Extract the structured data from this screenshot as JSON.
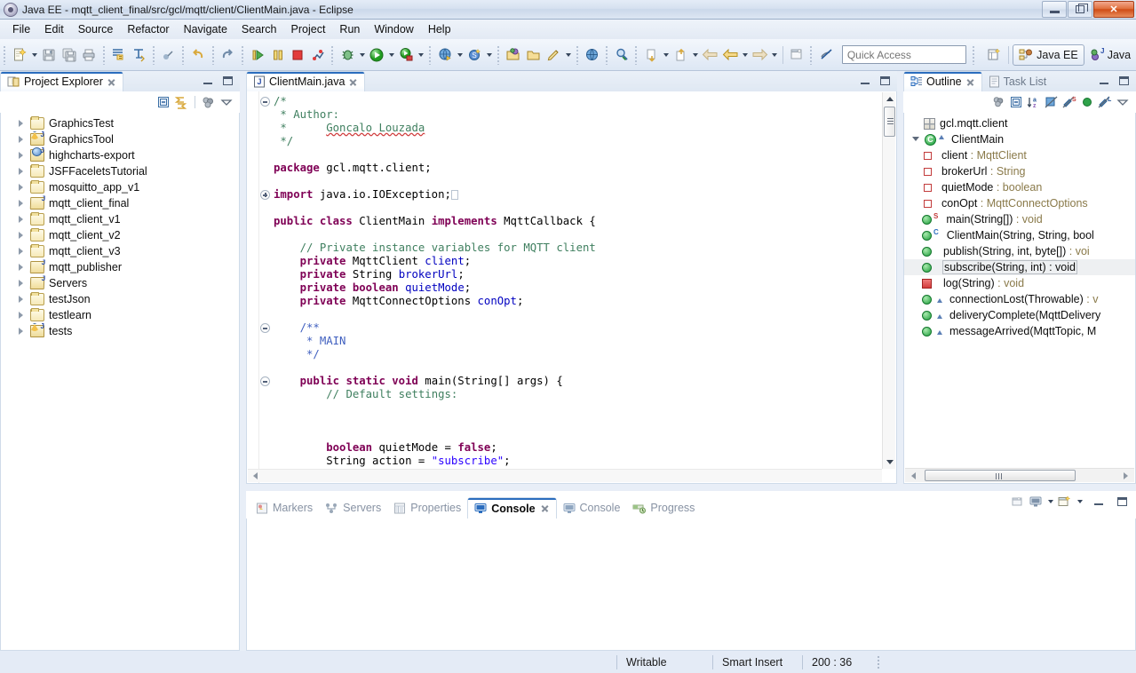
{
  "window": {
    "title": "Java EE - mqtt_client_final/src/gcl/mqtt/client/ClientMain.java - Eclipse",
    "app_icon": "eclipse-icon",
    "buttons": {
      "minimize": "minimize-button",
      "restore": "restore-button",
      "close": "close-button"
    }
  },
  "menubar": {
    "items": [
      "File",
      "Edit",
      "Source",
      "Refactor",
      "Navigate",
      "Search",
      "Project",
      "Run",
      "Window",
      "Help"
    ]
  },
  "toolbar": {
    "groups": [
      {
        "icons": [
          "new-wizard-icon",
          "new-wizard-dropdown",
          "save-icon",
          "save-all-icon",
          "print-icon"
        ]
      },
      {
        "icons": [
          "build-all-icon",
          "externalize-strings-icon"
        ]
      },
      {
        "icons": [
          "skip-breakpoints-icon"
        ]
      },
      {
        "icons": [
          "undo-icon"
        ]
      },
      {
        "icons": [
          "redo-icon"
        ]
      },
      {
        "icons": [
          "resume-icon",
          "suspend-icon",
          "terminate-icon",
          "disconnect-icon"
        ]
      },
      {
        "icons": [
          "debug-icon",
          "debug-dropdown",
          "run-icon",
          "run-dropdown",
          "run-coverage-icon",
          "run-coverage-dropdown"
        ]
      },
      {
        "icons": [
          "run-on-server-icon",
          "run-on-server-dropdown",
          "new-server-icon",
          "new-server-dropdown"
        ]
      },
      {
        "icons": [
          "open-type-icon",
          "open-task-icon",
          "new-java-class-icon",
          "new-java-class-dropdown"
        ]
      },
      {
        "icons": [
          "web-browser-icon"
        ]
      },
      {
        "icons": [
          "search-icon"
        ]
      },
      {
        "icons": [
          "next-annotation-icon",
          "next-annotation-dropdown",
          "previous-annotation-icon",
          "previous-annotation-dropdown",
          "back-icon",
          "back-dropdown",
          "forward-icon",
          "forward-dropdown"
        ]
      },
      {
        "icons": [
          "new-editor-icon",
          "toggle-mark-occurrences-icon"
        ]
      }
    ],
    "quick_access_placeholder": "Quick Access",
    "open-perspective-icon": "open-perspective-icon",
    "perspectives": [
      {
        "label": "Java EE",
        "icon": "java-ee-perspective-icon",
        "active": true
      },
      {
        "label": "Java",
        "icon": "java-perspective-icon",
        "active": false
      }
    ]
  },
  "project_explorer": {
    "tab_label": "Project Explorer",
    "tab_icon": "project-explorer-icon",
    "toolbar_icons": [
      "collapse-all-icon",
      "link-with-editor-icon",
      "view-menu-filters-icon",
      "view-menu-icon"
    ],
    "view_controls": [
      "minimize-view-icon",
      "maximize-view-icon"
    ],
    "items": [
      {
        "label": "GraphicsTest",
        "icon": "folder-icon"
      },
      {
        "label": "GraphicsTool",
        "icon": "java-project-warning-icon"
      },
      {
        "label": "highcharts-export",
        "icon": "java-project-icon"
      },
      {
        "label": "JSFFaceletsTutorial",
        "icon": "folder-icon"
      },
      {
        "label": "mosquitto_app_v1",
        "icon": "folder-icon"
      },
      {
        "label": "mqtt_client_final",
        "icon": "open-java-project-icon"
      },
      {
        "label": "mqtt_client_v1",
        "icon": "folder-icon"
      },
      {
        "label": "mqtt_client_v2",
        "icon": "folder-icon"
      },
      {
        "label": "mqtt_client_v3",
        "icon": "folder-icon"
      },
      {
        "label": "mqtt_publisher",
        "icon": "open-java-project-icon"
      },
      {
        "label": "Servers",
        "icon": "open-folder-icon"
      },
      {
        "label": "testJson",
        "icon": "folder-icon"
      },
      {
        "label": "testlearn",
        "icon": "folder-icon"
      },
      {
        "label": "tests",
        "icon": "java-project-warning-icon"
      }
    ]
  },
  "editor": {
    "tab_label": "ClientMain.java",
    "tab_icon": "java-file-icon",
    "view_controls": [
      "minimize-editor-icon",
      "maximize-editor-icon"
    ],
    "code_lines": [
      {
        "segments": [
          {
            "t": "/*",
            "c": "cmt"
          }
        ],
        "fold": "minus"
      },
      {
        "segments": [
          {
            "t": " * Author:",
            "c": "cmt"
          }
        ]
      },
      {
        "segments": [
          {
            "t": " *      ",
            "c": "cmt"
          },
          {
            "t": "Goncalo Louzada",
            "c": "cmt squig"
          }
        ]
      },
      {
        "segments": [
          {
            "t": " */",
            "c": "cmt"
          }
        ]
      },
      {
        "segments": [
          {
            "t": "",
            "c": ""
          }
        ]
      },
      {
        "segments": [
          {
            "t": "package",
            "c": "kw"
          },
          {
            "t": " gcl.mqtt.client;",
            "c": ""
          }
        ]
      },
      {
        "segments": [
          {
            "t": "",
            "c": ""
          }
        ]
      },
      {
        "segments": [
          {
            "t": "import",
            "c": "kw"
          },
          {
            "t": " java.io.IOException;",
            "c": ""
          },
          {
            "t": "BOX",
            "c": "box"
          }
        ],
        "fold": "plus"
      },
      {
        "segments": [
          {
            "t": "",
            "c": ""
          }
        ]
      },
      {
        "segments": [
          {
            "t": "public class",
            "c": "kw"
          },
          {
            "t": " ClientMain ",
            "c": ""
          },
          {
            "t": "implements",
            "c": "kw"
          },
          {
            "t": " MqttCallback {",
            "c": ""
          }
        ]
      },
      {
        "segments": [
          {
            "t": "",
            "c": ""
          }
        ]
      },
      {
        "segments": [
          {
            "t": "    // Private instance variables for MQTT client",
            "c": "cmt"
          }
        ]
      },
      {
        "segments": [
          {
            "t": "    private",
            "c": "kw"
          },
          {
            "t": " MqttClient ",
            "c": ""
          },
          {
            "t": "client",
            "c": "fld"
          },
          {
            "t": ";",
            "c": ""
          }
        ]
      },
      {
        "segments": [
          {
            "t": "    private",
            "c": "kw"
          },
          {
            "t": " String ",
            "c": ""
          },
          {
            "t": "brokerUrl",
            "c": "fld"
          },
          {
            "t": ";",
            "c": ""
          }
        ]
      },
      {
        "segments": [
          {
            "t": "    private boolean",
            "c": "kw"
          },
          {
            "t": " ",
            "c": ""
          },
          {
            "t": "quietMode",
            "c": "fld"
          },
          {
            "t": ";",
            "c": ""
          }
        ]
      },
      {
        "segments": [
          {
            "t": "    private",
            "c": "kw"
          },
          {
            "t": " MqttConnectOptions ",
            "c": ""
          },
          {
            "t": "conOpt",
            "c": "fld"
          },
          {
            "t": ";",
            "c": ""
          }
        ]
      },
      {
        "segments": [
          {
            "t": "",
            "c": ""
          }
        ]
      },
      {
        "segments": [
          {
            "t": "    /**",
            "c": "jdoc"
          }
        ],
        "fold": "minus"
      },
      {
        "segments": [
          {
            "t": "     * MAIN",
            "c": "jdoc"
          }
        ]
      },
      {
        "segments": [
          {
            "t": "     */",
            "c": "jdoc"
          }
        ]
      },
      {
        "segments": [
          {
            "t": "",
            "c": ""
          }
        ]
      },
      {
        "segments": [
          {
            "t": "    public static void",
            "c": "kw"
          },
          {
            "t": " main(String[] args) {",
            "c": ""
          }
        ],
        "fold": "minus"
      },
      {
        "segments": [
          {
            "t": "        // Default settings:",
            "c": "cmt"
          }
        ]
      },
      {
        "segments": [
          {
            "t": "",
            "c": ""
          }
        ]
      },
      {
        "segments": [
          {
            "t": "",
            "c": ""
          }
        ]
      },
      {
        "segments": [
          {
            "t": "",
            "c": ""
          }
        ]
      },
      {
        "segments": [
          {
            "t": "        boolean",
            "c": "kw"
          },
          {
            "t": " quietMode = ",
            "c": ""
          },
          {
            "t": "false",
            "c": "kw"
          },
          {
            "t": ";",
            "c": ""
          }
        ]
      },
      {
        "segments": [
          {
            "t": "        String action = ",
            "c": ""
          },
          {
            "t": "\"subscribe\"",
            "c": "str"
          },
          {
            "t": ";",
            "c": ""
          }
        ]
      }
    ]
  },
  "outline": {
    "tabs": [
      {
        "label": "Outline",
        "icon": "outline-icon",
        "active": true
      },
      {
        "label": "Task List",
        "icon": "task-list-icon",
        "active": false
      }
    ],
    "toolbar_icons": [
      "focus-on-active-task-icon",
      "collapse-all-icon",
      "sort-alphabetically-icon",
      "hide-fields-icon",
      "hide-static-icon",
      "hide-nonpublic-icon",
      "hide-local-types-icon",
      "view-menu-icon"
    ],
    "view_controls": [
      "minimize-view-icon",
      "maximize-view-icon"
    ],
    "items": [
      {
        "label": "gcl.mqtt.client",
        "kind": "package",
        "indent": 0
      },
      {
        "label": "ClientMain",
        "kind": "class",
        "indent": 0,
        "expanded": true
      },
      {
        "name": "client",
        "type": "MqttClient",
        "kind": "field",
        "indent": 1
      },
      {
        "name": "brokerUrl",
        "type": "String",
        "kind": "field",
        "indent": 1
      },
      {
        "name": "quietMode",
        "type": "boolean",
        "kind": "field",
        "indent": 1
      },
      {
        "name": "conOpt",
        "type": "MqttConnectOptions",
        "kind": "field",
        "indent": 1
      },
      {
        "name": "main(String[])",
        "type": "void",
        "kind": "method",
        "badge": "S",
        "indent": 1
      },
      {
        "name": "ClientMain(String, String, bool",
        "type": "",
        "kind": "method",
        "badge": "C",
        "indent": 1
      },
      {
        "name": "publish(String, int, byte[])",
        "type": "voi",
        "kind": "method",
        "indent": 1
      },
      {
        "name": "subscribe(String, int)",
        "type": "void",
        "kind": "method",
        "indent": 1,
        "selected": true
      },
      {
        "name": "log(String)",
        "type": "void",
        "kind": "method-private",
        "indent": 1
      },
      {
        "name": "connectionLost(Throwable)",
        "type": "v",
        "kind": "method",
        "override": true,
        "indent": 1
      },
      {
        "name": "deliveryComplete(MqttDelivery",
        "type": "",
        "kind": "method",
        "override": true,
        "indent": 1
      },
      {
        "name": "messageArrived(MqttTopic, M",
        "type": "",
        "kind": "method",
        "override": true,
        "indent": 1
      }
    ]
  },
  "console": {
    "tabs": [
      {
        "label": "Markers",
        "icon": "markers-icon",
        "active": false
      },
      {
        "label": "Servers",
        "icon": "servers-icon",
        "active": false
      },
      {
        "label": "Properties",
        "icon": "properties-icon",
        "active": false
      },
      {
        "label": "Console",
        "icon": "console-icon",
        "active": true
      },
      {
        "label": "Console",
        "icon": "console-icon",
        "active": false
      },
      {
        "label": "Progress",
        "icon": "progress-icon",
        "active": false
      }
    ],
    "toolbar_icons": [
      "open-console-icon",
      "display-selected-console-icon",
      "display-selected-console-dropdown",
      "new-console-view-icon",
      "new-console-view-dropdown"
    ],
    "view_controls": [
      "minimize-view-icon",
      "maximize-view-icon"
    ],
    "content": ""
  },
  "statusbar": {
    "writable": "Writable",
    "insert_mode": "Smart Insert",
    "cursor_position": "200 : 36"
  },
  "colors": {
    "accent": "#2b6dbe",
    "keyword": "#7f0055",
    "comment": "#3f7f5f",
    "javadoc": "#3f5fbf",
    "string": "#2a00ff",
    "field": "#0000c0",
    "chrome": "#e8eef7"
  }
}
